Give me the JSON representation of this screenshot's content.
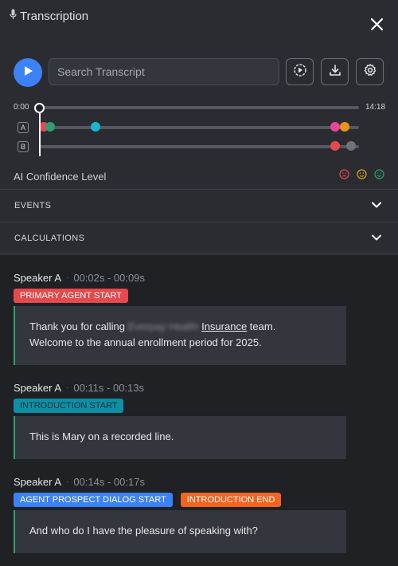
{
  "header": {
    "title": "Transcription"
  },
  "search": {
    "placeholder": "Search Transcript"
  },
  "timeline": {
    "start": "0:00",
    "end": "14:18",
    "speakers": [
      {
        "tag": "A",
        "markers": [
          {
            "at": 0.0,
            "color": "#e5484d"
          },
          {
            "at": 0.02,
            "color": "#2e9f6e"
          },
          {
            "at": 0.165,
            "color": "#19b6d2"
          },
          {
            "at": 0.93,
            "color": "#e8459b"
          },
          {
            "at": 0.96,
            "color": "#e6931a"
          }
        ]
      },
      {
        "tag": "B",
        "markers": [
          {
            "at": 0.93,
            "color": "#e5484d"
          },
          {
            "at": 0.98,
            "color": "#6f7278"
          }
        ]
      }
    ]
  },
  "confidence": {
    "label": "AI Confidence Level",
    "colors": [
      "#e5484d",
      "#e6a21a",
      "#2e9f6e"
    ]
  },
  "sections": [
    {
      "label": "EVENTS"
    },
    {
      "label": "CALCULATIONS"
    }
  ],
  "transcript": [
    {
      "speaker": "Speaker A",
      "time": "00:02s - 00:09s",
      "tags": [
        {
          "label": "PRIMARY AGENT START",
          "color": "red"
        }
      ],
      "line1_pre": "Thank you for calling ",
      "line1_blur": "Everpay Health",
      "line1_link": "Insurance",
      "line1_post": " team.",
      "line2": "Welcome to the annual enrollment period for 2025."
    },
    {
      "speaker": "Speaker A",
      "time": "00:11s - 00:13s",
      "tags": [
        {
          "label": "INTRODUCTION START",
          "color": "teal"
        }
      ],
      "text": "This is Mary on a recorded line."
    },
    {
      "speaker": "Speaker A",
      "time": "00:14s - 00:17s",
      "tags": [
        {
          "label": "AGENT PROSPECT DIALOG START",
          "color": "blue"
        },
        {
          "label": "INTRODUCTION END",
          "color": "orange"
        }
      ],
      "text": "And who do I have the pleasure of speaking with?"
    }
  ]
}
